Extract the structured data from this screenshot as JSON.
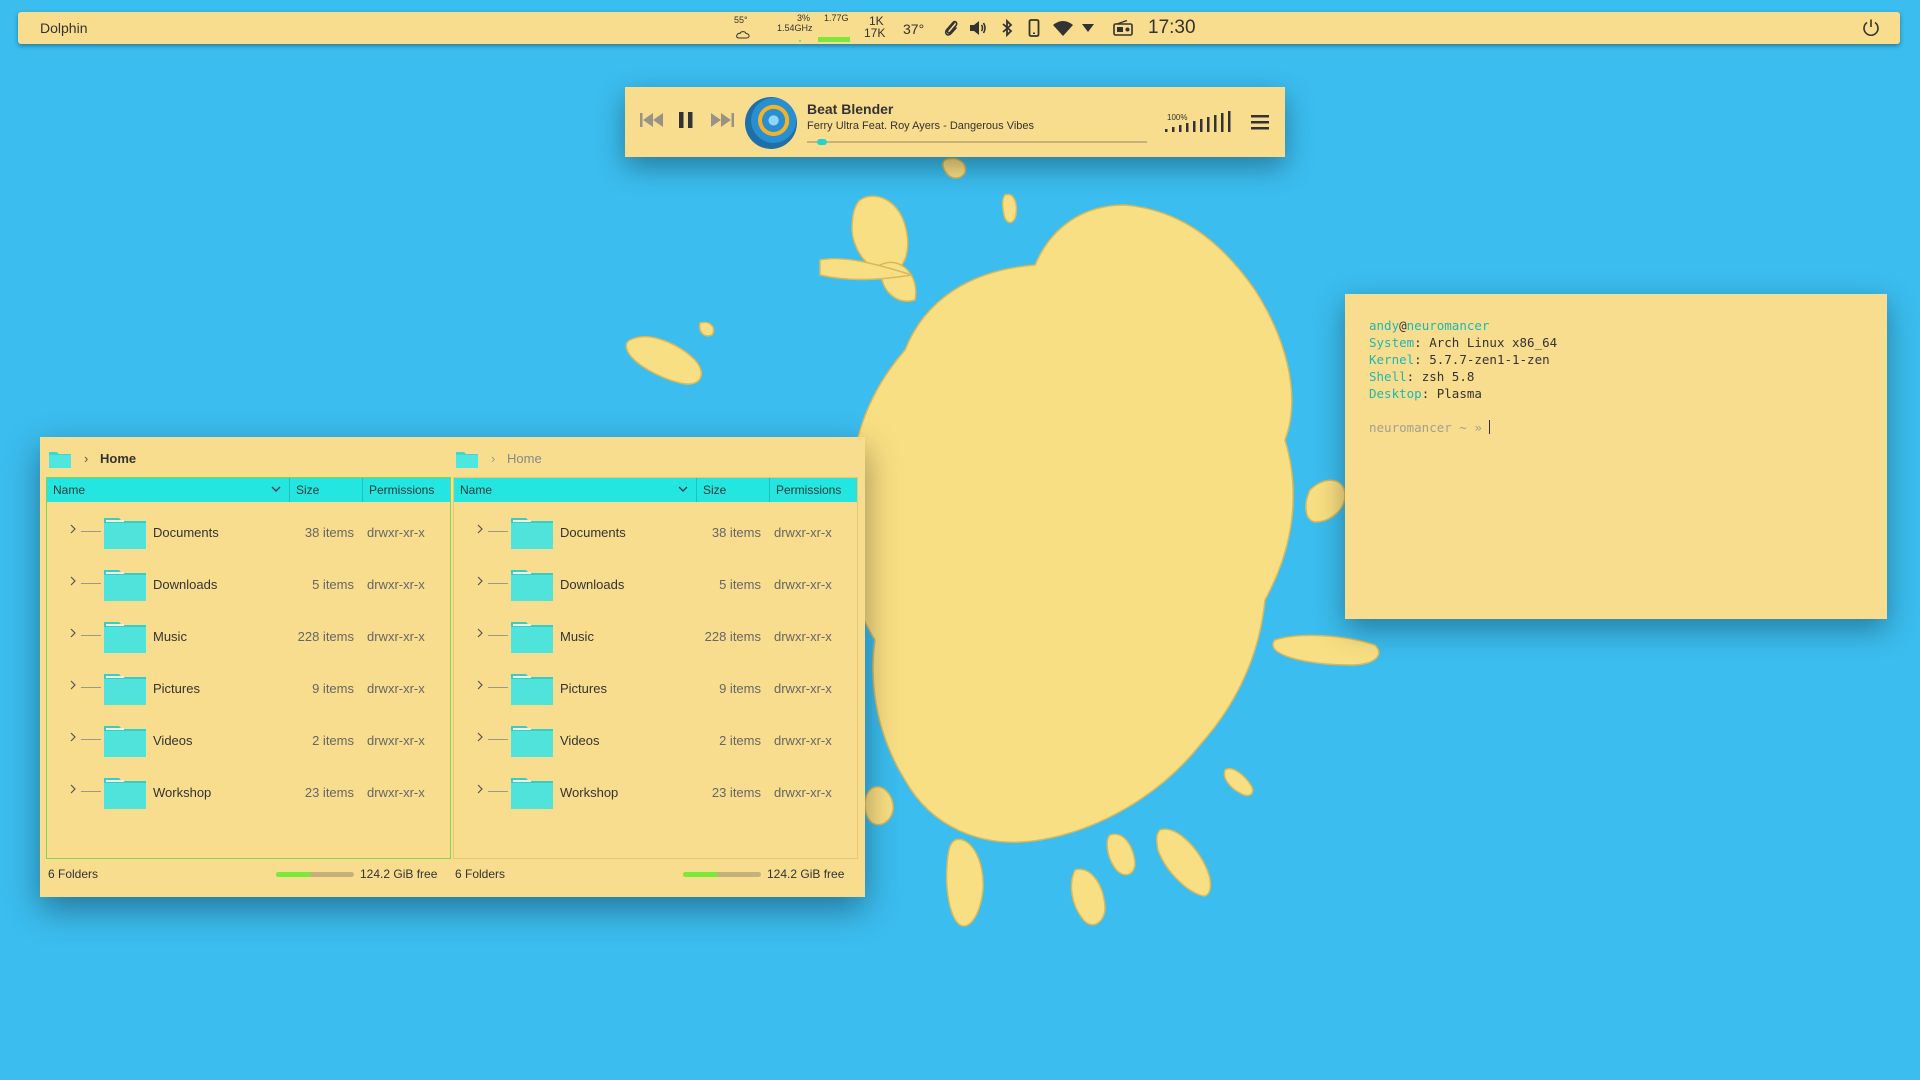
{
  "colors": {
    "desktop_bg": "#3bbdef",
    "window_bg": "#f8dd8e",
    "accent": "#22e6df",
    "green": "#7be83c"
  },
  "panel": {
    "app_name": "Dolphin",
    "weather": {
      "temp": "55°",
      "icon": "cloud-icon"
    },
    "cpu": {
      "usage": "3%",
      "freq": "1.54GHz"
    },
    "memory": {
      "used": "1.77G",
      "fill_percent": 100
    },
    "network": {
      "up": "1K",
      "down": "17K"
    },
    "temperature": "37°",
    "tray_icons": [
      "paperclip-icon",
      "volume-icon",
      "bluetooth-icon",
      "phone-icon",
      "wifi-icon",
      "triangle-down-icon",
      "radio-icon"
    ],
    "clock": "17:30",
    "power_icon": "power-icon"
  },
  "player": {
    "title": "Beat Blender",
    "artist": "Ferry Ultra Feat. Roy Ayers - Dangerous Vibes",
    "volume": "100%",
    "progress_fraction": 0.03
  },
  "dolphin": {
    "panes": [
      {
        "breadcrumb": "Home",
        "active": true,
        "columns": {
          "name": "Name",
          "size": "Size",
          "permissions": "Permissions"
        },
        "rows": [
          {
            "name": "Documents",
            "size": "38 items",
            "perm": "drwxr-xr-x"
          },
          {
            "name": "Downloads",
            "size": "5 items",
            "perm": "drwxr-xr-x"
          },
          {
            "name": "Music",
            "size": "228 items",
            "perm": "drwxr-xr-x"
          },
          {
            "name": "Pictures",
            "size": "9 items",
            "perm": "drwxr-xr-x"
          },
          {
            "name": "Videos",
            "size": "2 items",
            "perm": "drwxr-xr-x"
          },
          {
            "name": "Workshop",
            "size": "23 items",
            "perm": "drwxr-xr-x"
          }
        ],
        "status_count": "6 Folders",
        "free_space": "124.2 GiB free",
        "used_fraction": 0.45
      },
      {
        "breadcrumb": "Home",
        "active": false,
        "columns": {
          "name": "Name",
          "size": "Size",
          "permissions": "Permissions"
        },
        "rows": [
          {
            "name": "Documents",
            "size": "38 items",
            "perm": "drwxr-xr-x"
          },
          {
            "name": "Downloads",
            "size": "5 items",
            "perm": "drwxr-xr-x"
          },
          {
            "name": "Music",
            "size": "228 items",
            "perm": "drwxr-xr-x"
          },
          {
            "name": "Pictures",
            "size": "9 items",
            "perm": "drwxr-xr-x"
          },
          {
            "name": "Videos",
            "size": "2 items",
            "perm": "drwxr-xr-x"
          },
          {
            "name": "Workshop",
            "size": "23 items",
            "perm": "drwxr-xr-x"
          }
        ],
        "status_count": "6 Folders",
        "free_space": "124.2 GiB free",
        "used_fraction": 0.45
      }
    ]
  },
  "terminal": {
    "user": "andy",
    "at": "@",
    "host": "neuromancer",
    "info": [
      {
        "key": "System",
        "value": "Arch Linux x86_64"
      },
      {
        "key": "Kernel",
        "value": "5.7.7-zen1-1-zen"
      },
      {
        "key": "Shell",
        "value": "zsh 5.8"
      },
      {
        "key": "Desktop",
        "value": "Plasma"
      }
    ],
    "prompt": "neuromancer ~ »"
  }
}
